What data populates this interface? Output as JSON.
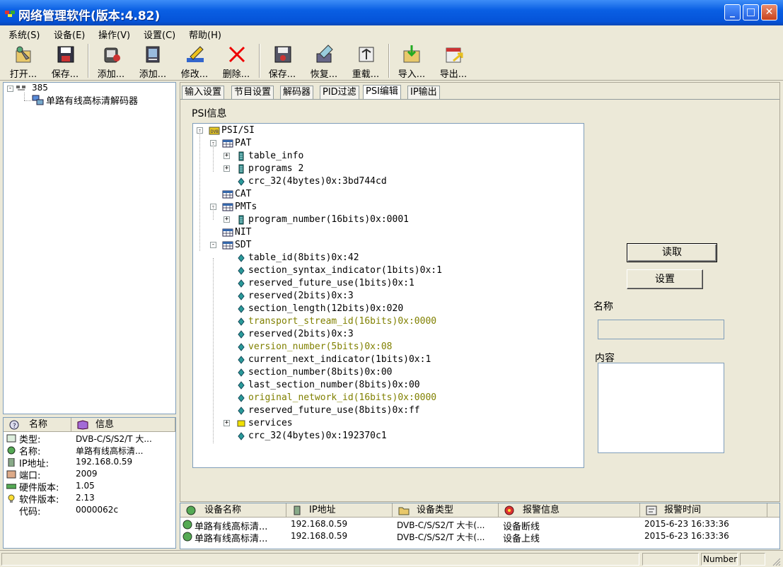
{
  "window": {
    "title": "网络管理软件(版本:4.82)"
  },
  "menu": [
    "系统(S)",
    "设备(E)",
    "操作(V)",
    "设置(C)",
    "帮助(H)"
  ],
  "toolbar": [
    {
      "label": "打开...",
      "icon": "open-icon"
    },
    {
      "label": "保存...",
      "icon": "save-icon"
    },
    {
      "label": "添加...",
      "icon": "add-group-icon"
    },
    {
      "label": "添加...",
      "icon": "add-device-icon"
    },
    {
      "label": "修改...",
      "icon": "edit-icon"
    },
    {
      "label": "删除...",
      "icon": "delete-icon"
    },
    {
      "label": "保存...",
      "icon": "save-config-icon"
    },
    {
      "label": "恢复...",
      "icon": "restore-icon"
    },
    {
      "label": "重载...",
      "icon": "reload-icon"
    },
    {
      "label": "导入...",
      "icon": "import-icon"
    },
    {
      "label": "导出...",
      "icon": "export-icon"
    }
  ],
  "device_tree": {
    "root": "385",
    "child": "单路有线高标清解码器"
  },
  "info_panel": {
    "headers": [
      "名称",
      "信息"
    ],
    "rows": [
      {
        "label": "类型:",
        "value": "DVB-C/S/S2/T 大..."
      },
      {
        "label": "名称:",
        "value": "单路有线高标清..."
      },
      {
        "label": "IP地址:",
        "value": "192.168.0.59"
      },
      {
        "label": "端口:",
        "value": "2009"
      },
      {
        "label": "硬件版本:",
        "value": "1.05"
      },
      {
        "label": "软件版本:",
        "value": "2.13"
      },
      {
        "label": "代码:",
        "value": "0000062c"
      }
    ]
  },
  "tabs": [
    "输入设置",
    "节目设置",
    "解码器",
    "PID过滤",
    "PSI编辑",
    "IP输出"
  ],
  "active_tab": "PSI编辑",
  "psi": {
    "section_label": "PSI信息",
    "tree": [
      {
        "text": "PSI/SI",
        "level": 0,
        "exp": "-",
        "icon": "folder"
      },
      {
        "text": "PAT",
        "level": 1,
        "exp": "-",
        "icon": "table"
      },
      {
        "text": "table_info",
        "level": 2,
        "exp": "+",
        "icon": "list"
      },
      {
        "text": "programs 2",
        "level": 2,
        "exp": "+",
        "icon": "list"
      },
      {
        "text": "crc_32(4bytes)0x:3bd744cd",
        "level": 2,
        "exp": "",
        "icon": "gem"
      },
      {
        "text": "CAT",
        "level": 1,
        "exp": "",
        "icon": "table"
      },
      {
        "text": "PMTs",
        "level": 1,
        "exp": "-",
        "icon": "table"
      },
      {
        "text": "program_number(16bits)0x:0001",
        "level": 2,
        "exp": "+",
        "icon": "list"
      },
      {
        "text": "NIT",
        "level": 1,
        "exp": "",
        "icon": "table"
      },
      {
        "text": "SDT",
        "level": 1,
        "exp": "-",
        "icon": "table"
      },
      {
        "text": "table_id(8bits)0x:42",
        "level": 2,
        "exp": "",
        "icon": "gem"
      },
      {
        "text": "section_syntax_indicator(1bits)0x:1",
        "level": 2,
        "exp": "",
        "icon": "gem"
      },
      {
        "text": "reserved_future_use(1bits)0x:1",
        "level": 2,
        "exp": "",
        "icon": "gem"
      },
      {
        "text": "reserved(2bits)0x:3",
        "level": 2,
        "exp": "",
        "icon": "gem"
      },
      {
        "text": "section_length(12bits)0x:020",
        "level": 2,
        "exp": "",
        "icon": "gem"
      },
      {
        "text": "transport_stream_id(16bits)0x:0000",
        "level": 2,
        "exp": "",
        "icon": "gem",
        "olive": true
      },
      {
        "text": "reserved(2bits)0x:3",
        "level": 2,
        "exp": "",
        "icon": "gem"
      },
      {
        "text": "version_number(5bits)0x:08",
        "level": 2,
        "exp": "",
        "icon": "gem",
        "olive": true
      },
      {
        "text": "current_next_indicator(1bits)0x:1",
        "level": 2,
        "exp": "",
        "icon": "gem"
      },
      {
        "text": "section_number(8bits)0x:00",
        "level": 2,
        "exp": "",
        "icon": "gem"
      },
      {
        "text": "last_section_number(8bits)0x:00",
        "level": 2,
        "exp": "",
        "icon": "gem"
      },
      {
        "text": "original_network_id(16bits)0x:0000",
        "level": 2,
        "exp": "",
        "icon": "gem",
        "olive": true
      },
      {
        "text": "reserved_future_use(8bits)0x:ff",
        "level": 2,
        "exp": "",
        "icon": "gem"
      },
      {
        "text": "services",
        "level": 2,
        "exp": "+",
        "icon": "yellow"
      },
      {
        "text": "crc_32(4bytes)0x:192370c1",
        "level": 2,
        "exp": "",
        "icon": "gem"
      }
    ],
    "read_button": "读取",
    "set_button": "设置",
    "name_label": "名称",
    "name_value": "",
    "content_label": "内容",
    "content_value": ""
  },
  "alarm_table": {
    "headers": [
      "设备名称",
      "IP地址",
      "设备类型",
      "报警信息",
      "报警时间"
    ],
    "rows": [
      [
        "单路有线高标清...",
        "192.168.0.59",
        "DVB-C/S/S2/T 大卡(...",
        "设备断线",
        "2015-6-23 16:33:36"
      ],
      [
        "单路有线高标清...",
        "192.168.0.59",
        "DVB-C/S/S2/T 大卡(...",
        "设备上线",
        "2015-6-23 16:33:36"
      ]
    ]
  },
  "status_bar": {
    "mode": "Number"
  },
  "colors": {
    "titlebar": "#0a5fe3",
    "olive_text": "#808000",
    "panel_bg": "#ece9d8"
  }
}
